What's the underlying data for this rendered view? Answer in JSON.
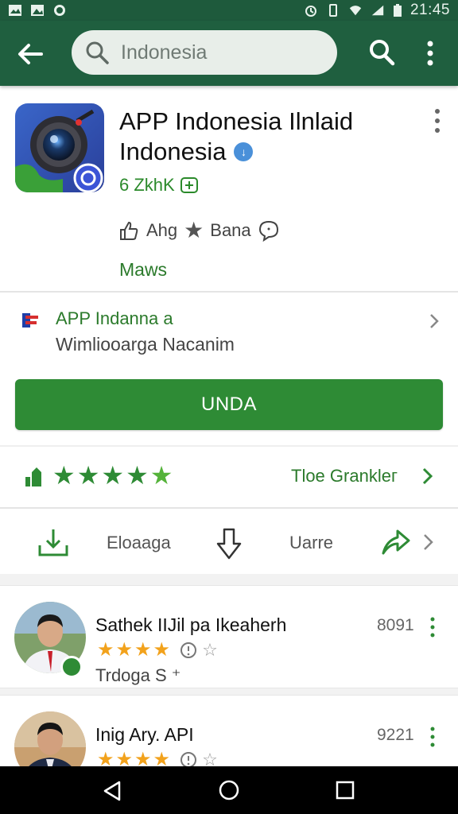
{
  "status_bar": {
    "time": "21:45",
    "icons": [
      "image-icon",
      "photo-icon",
      "whatsapp-icon",
      "alarm-icon",
      "vibrate-icon",
      "wifi-icon",
      "signal-icon",
      "battery-icon"
    ]
  },
  "appbar": {
    "search_query": "Indonesia"
  },
  "app": {
    "title_line1": "APP Indonesia Ilnlaid",
    "title_line2": "Indonesia",
    "downloads": "6 ZkhK",
    "likes_label": "Ahg",
    "rating_label": "Bana",
    "maws": "Maws"
  },
  "developer": {
    "name": "APP Indanna a",
    "subtitle": "Wimliooarga Nacanim"
  },
  "install": {
    "label": "UNDA"
  },
  "rating_row": {
    "stars_count": 5,
    "rank_label": "Tloe Granklег"
  },
  "action_row": {
    "label1": "Eloaaga",
    "label2": "Uarre"
  },
  "reviews": [
    {
      "name": "Sathek IIJil pa Ikeaherh",
      "date": "8091",
      "text": "Trdoga S ⁺"
    },
    {
      "name": "Inig Ary. API",
      "date": "9221",
      "text": ""
    }
  ],
  "colors": {
    "appbar": "#1f5f3f",
    "accent_green": "#2e8b35",
    "star_orange": "#f2a21c"
  }
}
